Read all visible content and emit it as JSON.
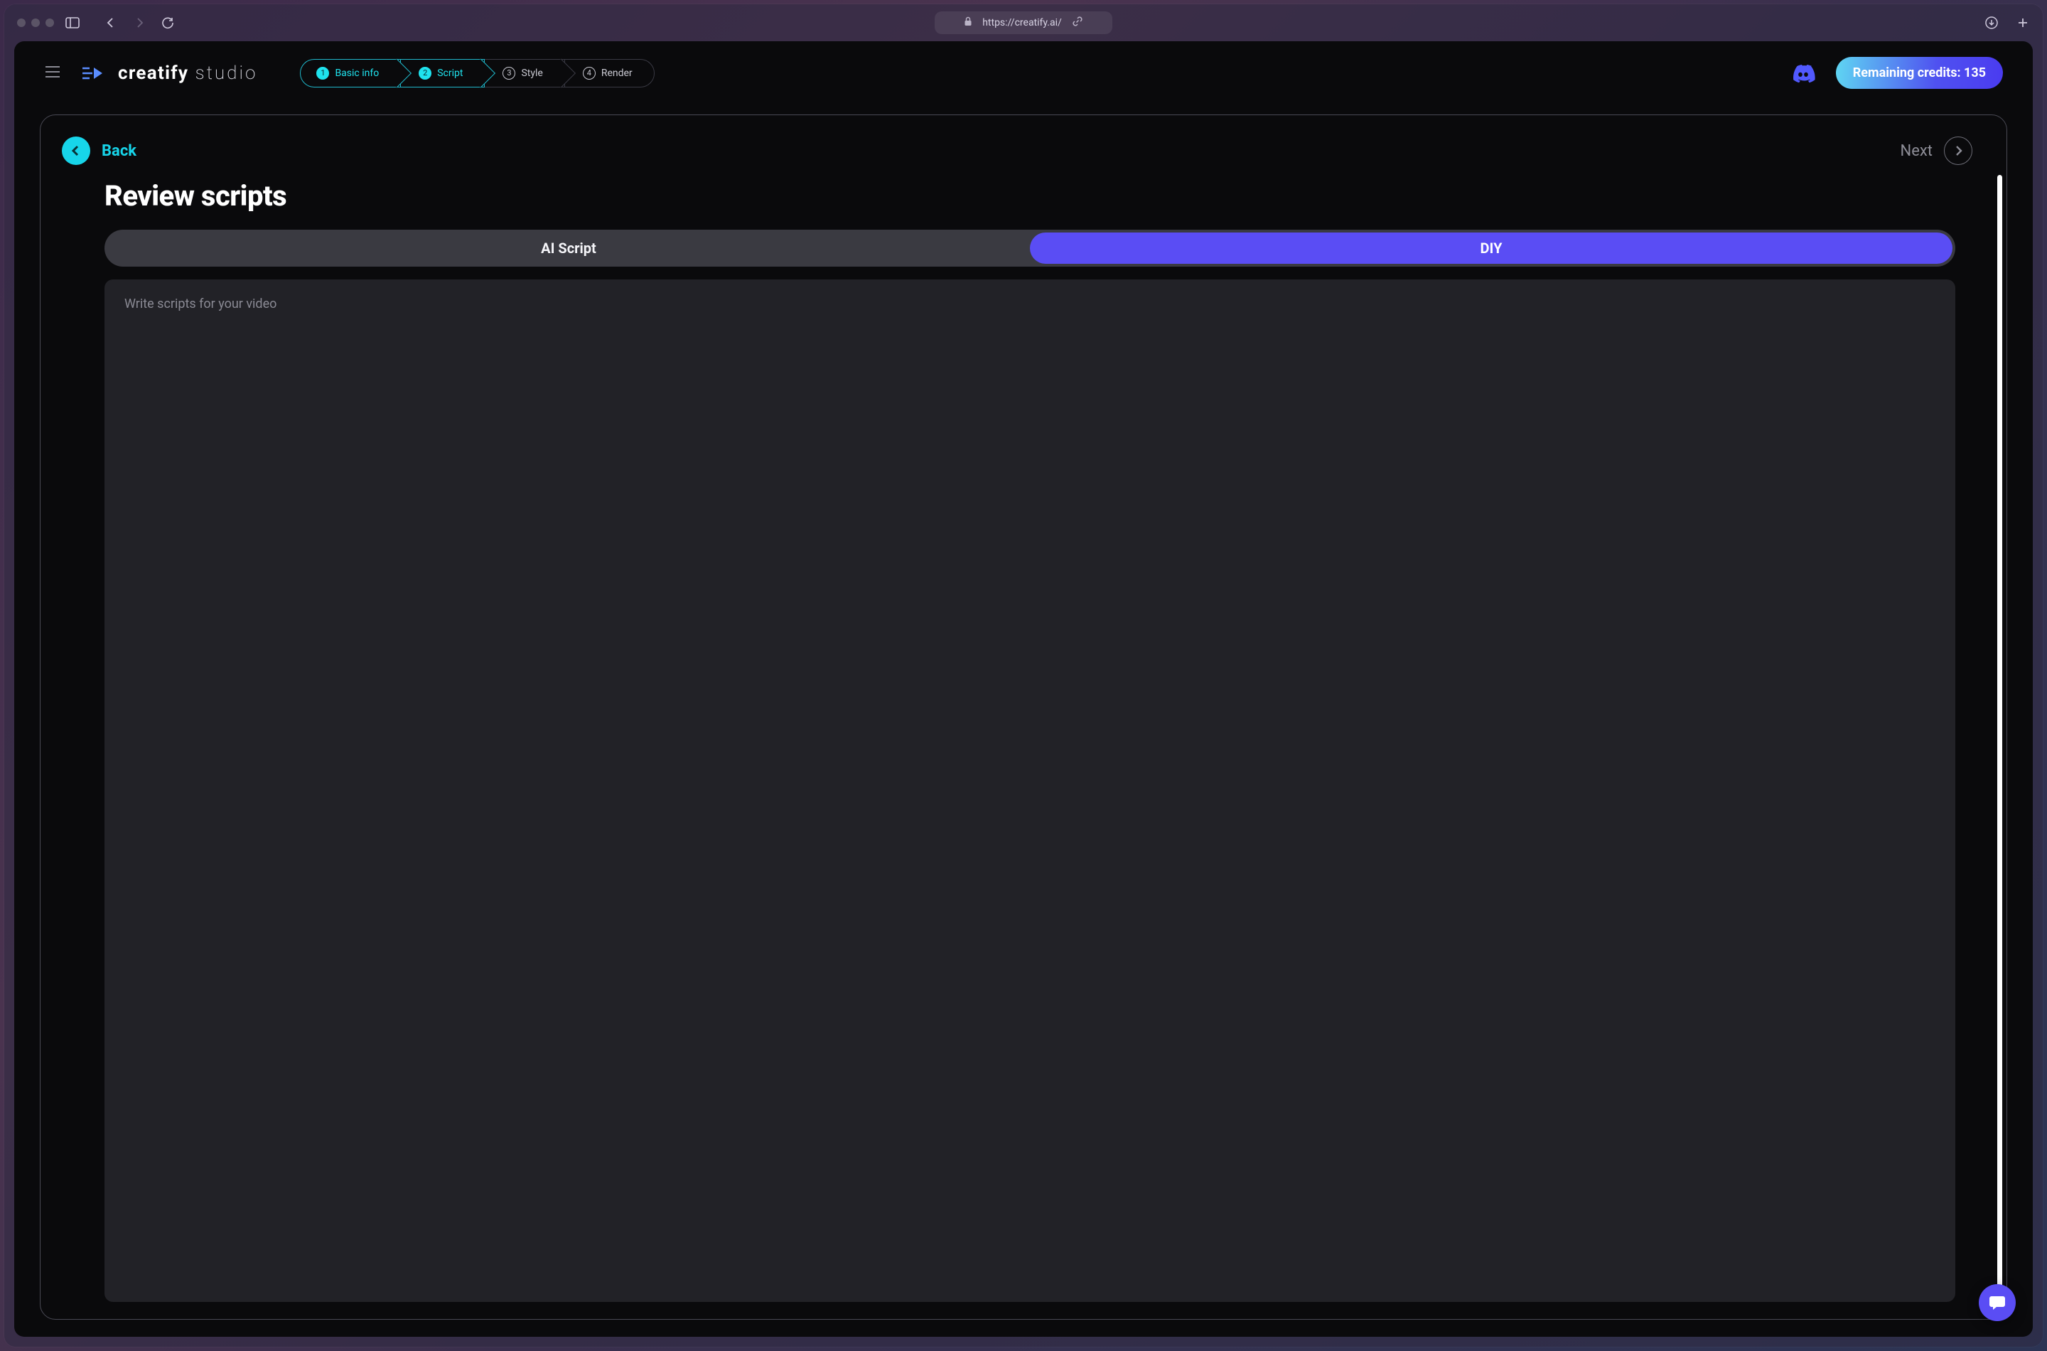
{
  "browser": {
    "url": "https://creatify.ai/"
  },
  "header": {
    "brand_bold": "creatify",
    "brand_thin": "studio",
    "credits_label": "Remaining credits: 135"
  },
  "stepper": {
    "steps": [
      {
        "num": "1",
        "label": "Basic info",
        "active": true
      },
      {
        "num": "2",
        "label": "Script",
        "active": true
      },
      {
        "num": "3",
        "label": "Style",
        "active": false
      },
      {
        "num": "4",
        "label": "Render",
        "active": false
      }
    ]
  },
  "card": {
    "back_label": "Back",
    "next_label": "Next",
    "title": "Review scripts",
    "tabs": {
      "ai": "AI Script",
      "diy": "DIY"
    },
    "editor_placeholder": "Write scripts for your video"
  }
}
